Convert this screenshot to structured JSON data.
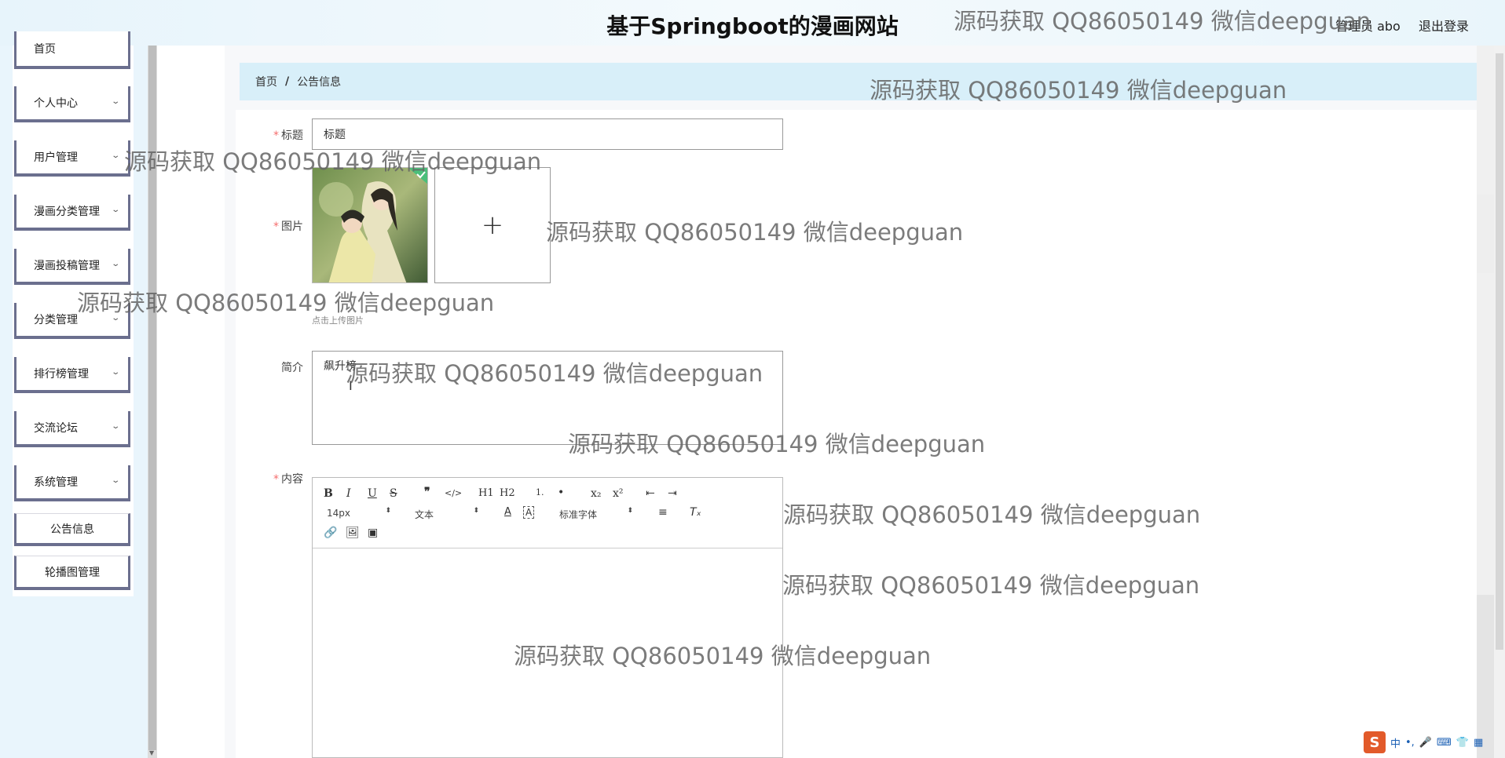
{
  "header": {
    "site_title": "基于Springboot的漫画网站",
    "user": "管理员 abo",
    "logout": "退出登录"
  },
  "sidebar": {
    "items": [
      {
        "label": "首页",
        "has_chevron": false
      },
      {
        "label": "个人中心",
        "has_chevron": true
      },
      {
        "label": "用户管理",
        "has_chevron": true
      },
      {
        "label": "漫画分类管理",
        "has_chevron": true
      },
      {
        "label": "漫画投稿管理",
        "has_chevron": true
      },
      {
        "label": "分类管理",
        "has_chevron": true
      },
      {
        "label": "排行榜管理",
        "has_chevron": true
      },
      {
        "label": "交流论坛",
        "has_chevron": true
      },
      {
        "label": "系统管理",
        "has_chevron": true
      }
    ],
    "sub_items": [
      {
        "label": "公告信息"
      },
      {
        "label": "轮播图管理"
      }
    ]
  },
  "breadcrumb": {
    "home": "首页",
    "separator": "/",
    "current": "公告信息"
  },
  "form": {
    "title_label": "标题",
    "title_value": "标题",
    "image_label": "图片",
    "upload_tip": "点击上传图片",
    "upload_plus": "+",
    "intro_label": "简介",
    "intro_value": "飙升榜",
    "content_label": "内容",
    "required_mark": "*"
  },
  "editor": {
    "buttons_row1": [
      "B",
      "I",
      "U",
      "S",
      "❞",
      "</>",
      "H1",
      "H2",
      "1.",
      "•",
      "x₂",
      "x²",
      "⇤",
      "⇥"
    ],
    "font_size": "14px",
    "text_style": "文本",
    "font_family": "标准字体"
  },
  "watermark": {
    "text": "源码获取 QQ86050149 微信deepguan"
  },
  "ime": {
    "logo": "S",
    "lang": "中",
    "icons": [
      "•,",
      "🎤",
      "⌨",
      "👕",
      "▦"
    ]
  },
  "colors": {
    "header_bg": "#e7f4fb",
    "breadcrumb_bg": "#d8eff9",
    "menu_border": "#6b6f8e",
    "required": "#f56c6c"
  }
}
